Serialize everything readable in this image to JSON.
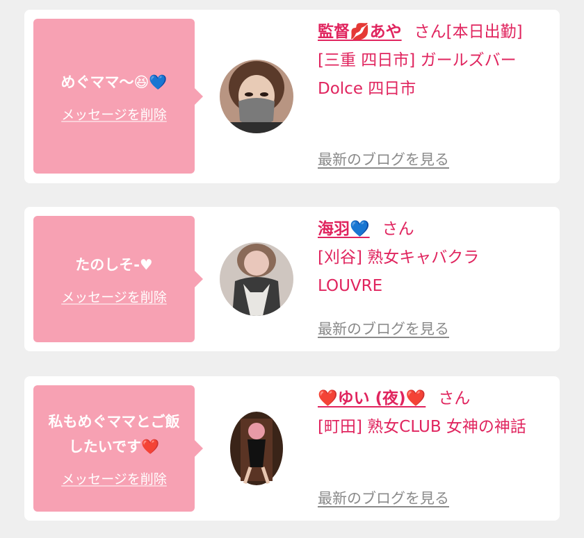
{
  "cards": [
    {
      "message": "めぐママ〜😆💙",
      "delete_label": "メッセージを削除",
      "name": "監督💋あや",
      "san": "さん",
      "status": "[本日出勤]",
      "shop": "[三重 四日市] ガールズバー Dolce 四日市",
      "blog_label": "最新のブログを見る"
    },
    {
      "message": "たのしそ-♥",
      "delete_label": "メッセージを削除",
      "name": "海羽💙",
      "san": "さん",
      "status": "",
      "shop": "[刈谷] 熟女キャバクラ LOUVRE",
      "blog_label": "最新のブログを見る"
    },
    {
      "message": "私もめぐママとご飯したいです❤️",
      "delete_label": "メッセージを削除",
      "name": "❤️ゆい (夜)❤️",
      "san": "さん",
      "status": "",
      "shop": "[町田] 熟女CLUB 女神の神話",
      "blog_label": "最新のブログを見る"
    }
  ],
  "colors": {
    "background": "#efefef",
    "bubble": "#f7a1b3",
    "link_pink": "#e0245e",
    "blog_gray": "#8a8a8a"
  }
}
